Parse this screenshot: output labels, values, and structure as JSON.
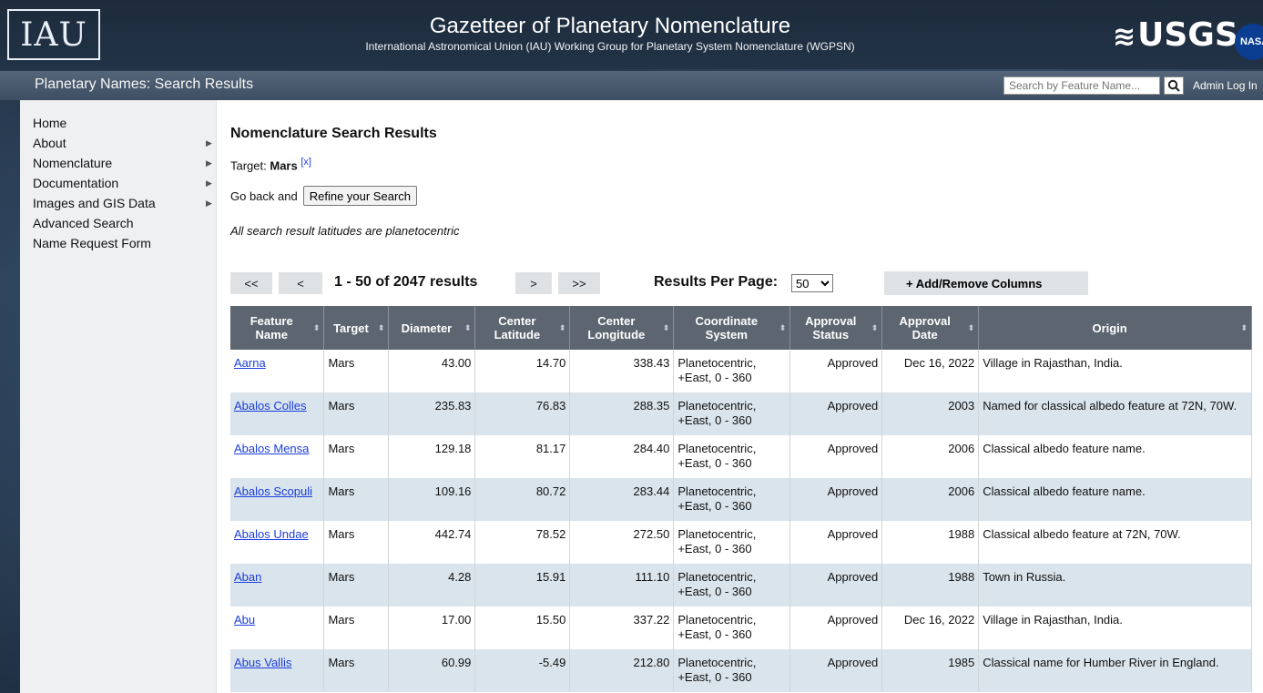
{
  "header": {
    "logo_text": "IAU",
    "title": "Gazetteer of Planetary Nomenclature",
    "subtitle": "International Astronomical Union (IAU) Working Group for Planetary System Nomenclature (WGPSN)",
    "usgs_text": "USGS",
    "nasa_text": "NASA"
  },
  "navbar": {
    "title": "Planetary Names: Search Results",
    "search_placeholder": "Search by Feature Name...",
    "admin_link": "Admin Log In"
  },
  "sidebar": {
    "items": [
      {
        "label": "Home",
        "has_submenu": false
      },
      {
        "label": "About",
        "has_submenu": true
      },
      {
        "label": "Nomenclature",
        "has_submenu": true
      },
      {
        "label": "Documentation",
        "has_submenu": true
      },
      {
        "label": "Images and GIS Data",
        "has_submenu": true
      },
      {
        "label": "Advanced Search",
        "has_submenu": false
      },
      {
        "label": "Name Request Form",
        "has_submenu": false
      }
    ]
  },
  "content": {
    "heading": "Nomenclature Search Results",
    "target_label": "Target:",
    "target_value": "Mars",
    "target_clear": "[x]",
    "go_back_text": "Go back and",
    "refine_button": "Refine your Search",
    "note": "All search result latitudes are planetocentric",
    "pager": {
      "first": "<<",
      "prev": "<",
      "range": "1 - 50 of 2047 results",
      "next": ">",
      "last": ">>",
      "rpp_label": "Results Per Page:",
      "rpp_value": "50",
      "columns_button": "+ Add/Remove Columns"
    }
  },
  "table": {
    "headers": [
      "Feature Name",
      "Target",
      "Diameter",
      "Center Latitude",
      "Center Longitude",
      "Coordinate System",
      "Approval Status",
      "Approval Date",
      "Origin"
    ],
    "rows": [
      [
        "Aarna",
        "Mars",
        "43.00",
        "14.70",
        "338.43",
        "Planetocentric, +East, 0 - 360",
        "Approved",
        "Dec 16, 2022",
        "Village in Rajasthan, India."
      ],
      [
        "Abalos Colles",
        "Mars",
        "235.83",
        "76.83",
        "288.35",
        "Planetocentric, +East, 0 - 360",
        "Approved",
        "2003",
        "Named for classical albedo feature at 72N, 70W."
      ],
      [
        "Abalos Mensa",
        "Mars",
        "129.18",
        "81.17",
        "284.40",
        "Planetocentric, +East, 0 - 360",
        "Approved",
        "2006",
        "Classical albedo feature name."
      ],
      [
        "Abalos Scopuli",
        "Mars",
        "109.16",
        "80.72",
        "283.44",
        "Planetocentric, +East, 0 - 360",
        "Approved",
        "2006",
        "Classical albedo feature name."
      ],
      [
        "Abalos Undae",
        "Mars",
        "442.74",
        "78.52",
        "272.50",
        "Planetocentric, +East, 0 - 360",
        "Approved",
        "1988",
        "Classical albedo feature at 72N, 70W."
      ],
      [
        "Aban",
        "Mars",
        "4.28",
        "15.91",
        "111.10",
        "Planetocentric, +East, 0 - 360",
        "Approved",
        "1988",
        "Town in Russia."
      ],
      [
        "Abu",
        "Mars",
        "17.00",
        "15.50",
        "337.22",
        "Planetocentric, +East, 0 - 360",
        "Approved",
        "Dec 16, 2022",
        "Village in Rajasthan, India."
      ],
      [
        "Abus Vallis",
        "Mars",
        "60.99",
        "-5.49",
        "212.80",
        "Planetocentric, +East, 0 - 360",
        "Approved",
        "1985",
        "Classical name for Humber River in England."
      ]
    ]
  }
}
